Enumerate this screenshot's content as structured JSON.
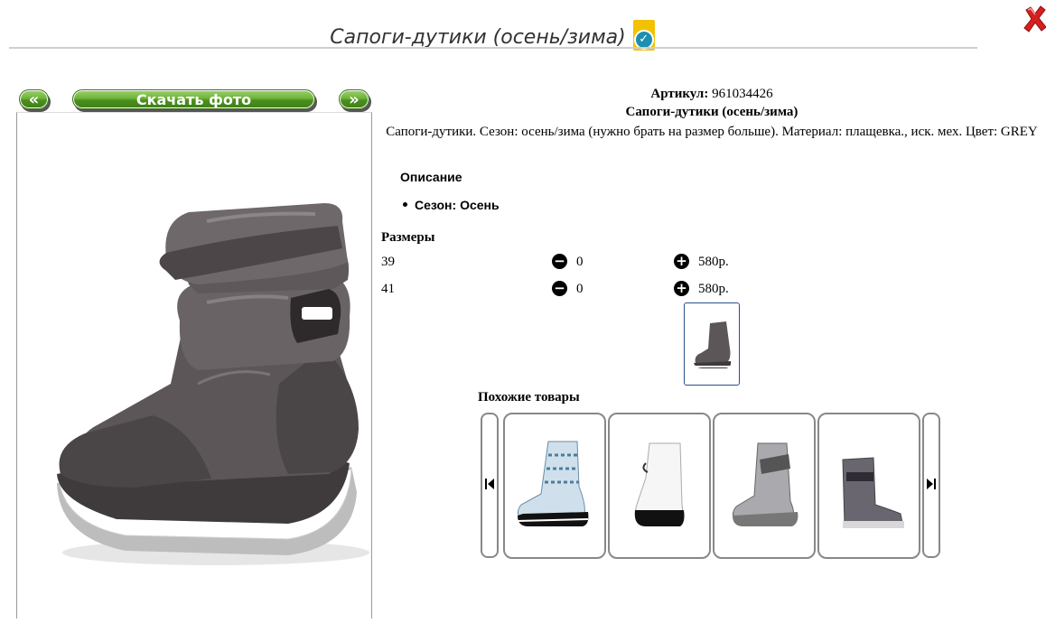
{
  "header": {
    "title": "Сапоги-дутики (осень/зима)"
  },
  "gallery": {
    "prev_label": "«",
    "download_label": "Скачать фото",
    "next_label": "»"
  },
  "product": {
    "article_label": "Артикул:",
    "article_value": "961034426",
    "name": "Сапоги-дутики (осень/зима)",
    "description": "Сапоги-дутики. Сезон: осень/зима (нужно брать на размер больше). Материал: плащевка., иск. мех. Цвет: GREY"
  },
  "details": {
    "heading": "Описание",
    "items": [
      "Сезон: Осень"
    ]
  },
  "sizes": {
    "heading": "Размеры",
    "rows": [
      {
        "size": "39",
        "qty": "0",
        "price": "580р."
      },
      {
        "size": "41",
        "qty": "0",
        "price": "580р."
      }
    ]
  },
  "similar": {
    "heading": "Похожие товары",
    "items": [
      {
        "icon": "patterned-boot-image"
      },
      {
        "icon": "white-boot-image"
      },
      {
        "icon": "silver-boot-image"
      },
      {
        "icon": "grey-boot-image"
      }
    ]
  },
  "colors": {
    "accent_green": "#6fb23a",
    "close_red": "#d42020",
    "badge_yellow": "#f2c200",
    "check_blue": "#1e8fb0"
  }
}
